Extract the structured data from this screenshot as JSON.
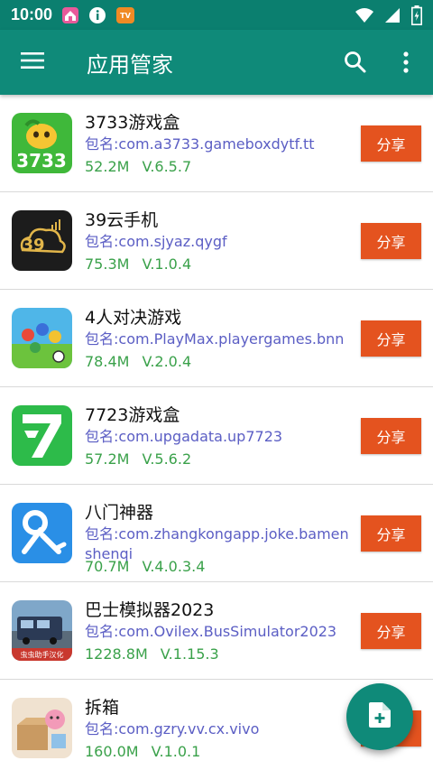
{
  "status_bar": {
    "time": "10:00",
    "left_icons": [
      "home-app-icon",
      "info-icon",
      "tv-app-icon"
    ],
    "right_icons": [
      "wifi-icon",
      "signal-icon",
      "battery-icon"
    ]
  },
  "toolbar": {
    "title": "应用管家",
    "menu_icon": "menu-icon",
    "search_icon": "search-icon",
    "more_icon": "more-vert-icon"
  },
  "apps": [
    {
      "name": "3733游戏盒",
      "package": "包名:com.a3733.gameboxdytf.tt",
      "size": "52.2M",
      "version": "V.6.5.7",
      "share": "分享",
      "icon": "3733-game-box-icon"
    },
    {
      "name": "39云手机",
      "package": "包名:com.sjyaz.qygf",
      "size": "75.3M",
      "version": "V.1.0.4",
      "share": "分享",
      "icon": "39-cloud-phone-icon"
    },
    {
      "name": "4人对决游戏",
      "package": "包名:com.PlayMax.playergames.bnn",
      "size": "78.4M",
      "version": "V.2.0.4",
      "share": "分享",
      "icon": "four-player-game-icon"
    },
    {
      "name": "7723游戏盒",
      "package": "包名:com.upgadata.up7723",
      "size": "57.2M",
      "version": "V.5.6.2",
      "share": "分享",
      "icon": "7723-game-box-icon"
    },
    {
      "name": "八门神器",
      "package": "包名:com.zhangkongapp.joke.bamenshenqi",
      "size": "70.7M",
      "version": "V.4.0.3.4",
      "share": "分享",
      "icon": "bamen-key-wrench-icon"
    },
    {
      "name": "巴士模拟器2023",
      "package": "包名:com.Ovilex.BusSimulator2023",
      "size": "1228.8M",
      "version": "V.1.15.3",
      "share": "分享",
      "icon": "bus-simulator-icon",
      "icon_caption": "虫虫助手汉化"
    },
    {
      "name": "拆箱",
      "package": "包名:com.gzry.vv.cx.vivo",
      "size": "160.0M",
      "version": "V.1.0.1",
      "share": "分享",
      "icon": "unpacking-icon"
    }
  ],
  "fab": {
    "icon": "add-file-icon"
  },
  "colors": {
    "status_bar": "#0b7f6f",
    "toolbar": "#0f8a79",
    "share_button": "#e4531f",
    "package_text": "#5b5ec4",
    "meta_text": "#3aa14a"
  }
}
